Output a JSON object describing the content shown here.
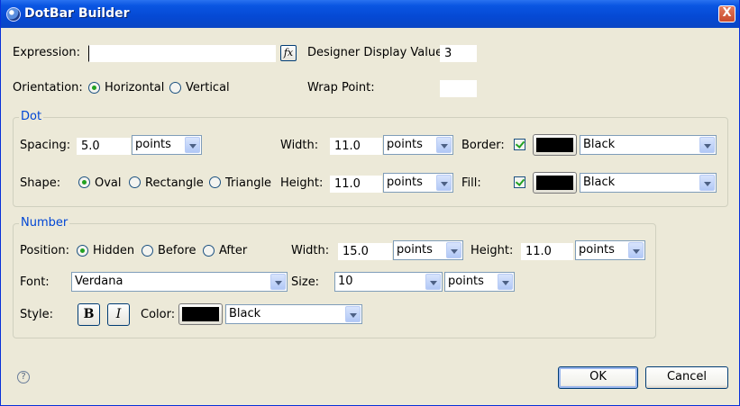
{
  "window": {
    "title": "DotBar Builder",
    "close_label": "X"
  },
  "expression": {
    "label": "Expression:",
    "value": "",
    "fx_label": "fx",
    "designer_label": "Designer Display Value:",
    "designer_value": "3"
  },
  "orientation": {
    "label": "Orientation:",
    "horizontal": "Horizontal",
    "vertical": "Vertical",
    "selected": "Horizontal",
    "wrap_label": "Wrap Point:",
    "wrap_value": ""
  },
  "dot": {
    "title": "Dot",
    "spacing_label": "Spacing:",
    "spacing_value": "5.0",
    "spacing_unit": "points",
    "width_label": "Width:",
    "width_value": "11.0",
    "width_unit": "points",
    "height_label": "Height:",
    "height_value": "11.0",
    "height_unit": "points",
    "shape_label": "Shape:",
    "shape_oval": "Oval",
    "shape_rectangle": "Rectangle",
    "shape_triangle": "Triangle",
    "shape_selected": "Oval",
    "border_label": "Border:",
    "border_checked": true,
    "border_color": "#000000",
    "border_color_name": "Black",
    "fill_label": "Fill:",
    "fill_checked": true,
    "fill_color": "#000000",
    "fill_color_name": "Black"
  },
  "number": {
    "title": "Number",
    "position_label": "Position:",
    "pos_hidden": "Hidden",
    "pos_before": "Before",
    "pos_after": "After",
    "pos_selected": "Hidden",
    "width_label": "Width:",
    "width_value": "15.0",
    "width_unit": "points",
    "height_label": "Height:",
    "height_value": "11.0",
    "height_unit": "points",
    "font_label": "Font:",
    "font_value": "Verdana",
    "size_label": "Size:",
    "size_value": "10",
    "size_unit": "points",
    "style_label": "Style:",
    "bold_label": "B",
    "italic_label": "I",
    "color_label": "Color:",
    "color": "#000000",
    "color_name": "Black"
  },
  "footer": {
    "help_label": "?",
    "ok_label": "OK",
    "cancel_label": "Cancel"
  }
}
